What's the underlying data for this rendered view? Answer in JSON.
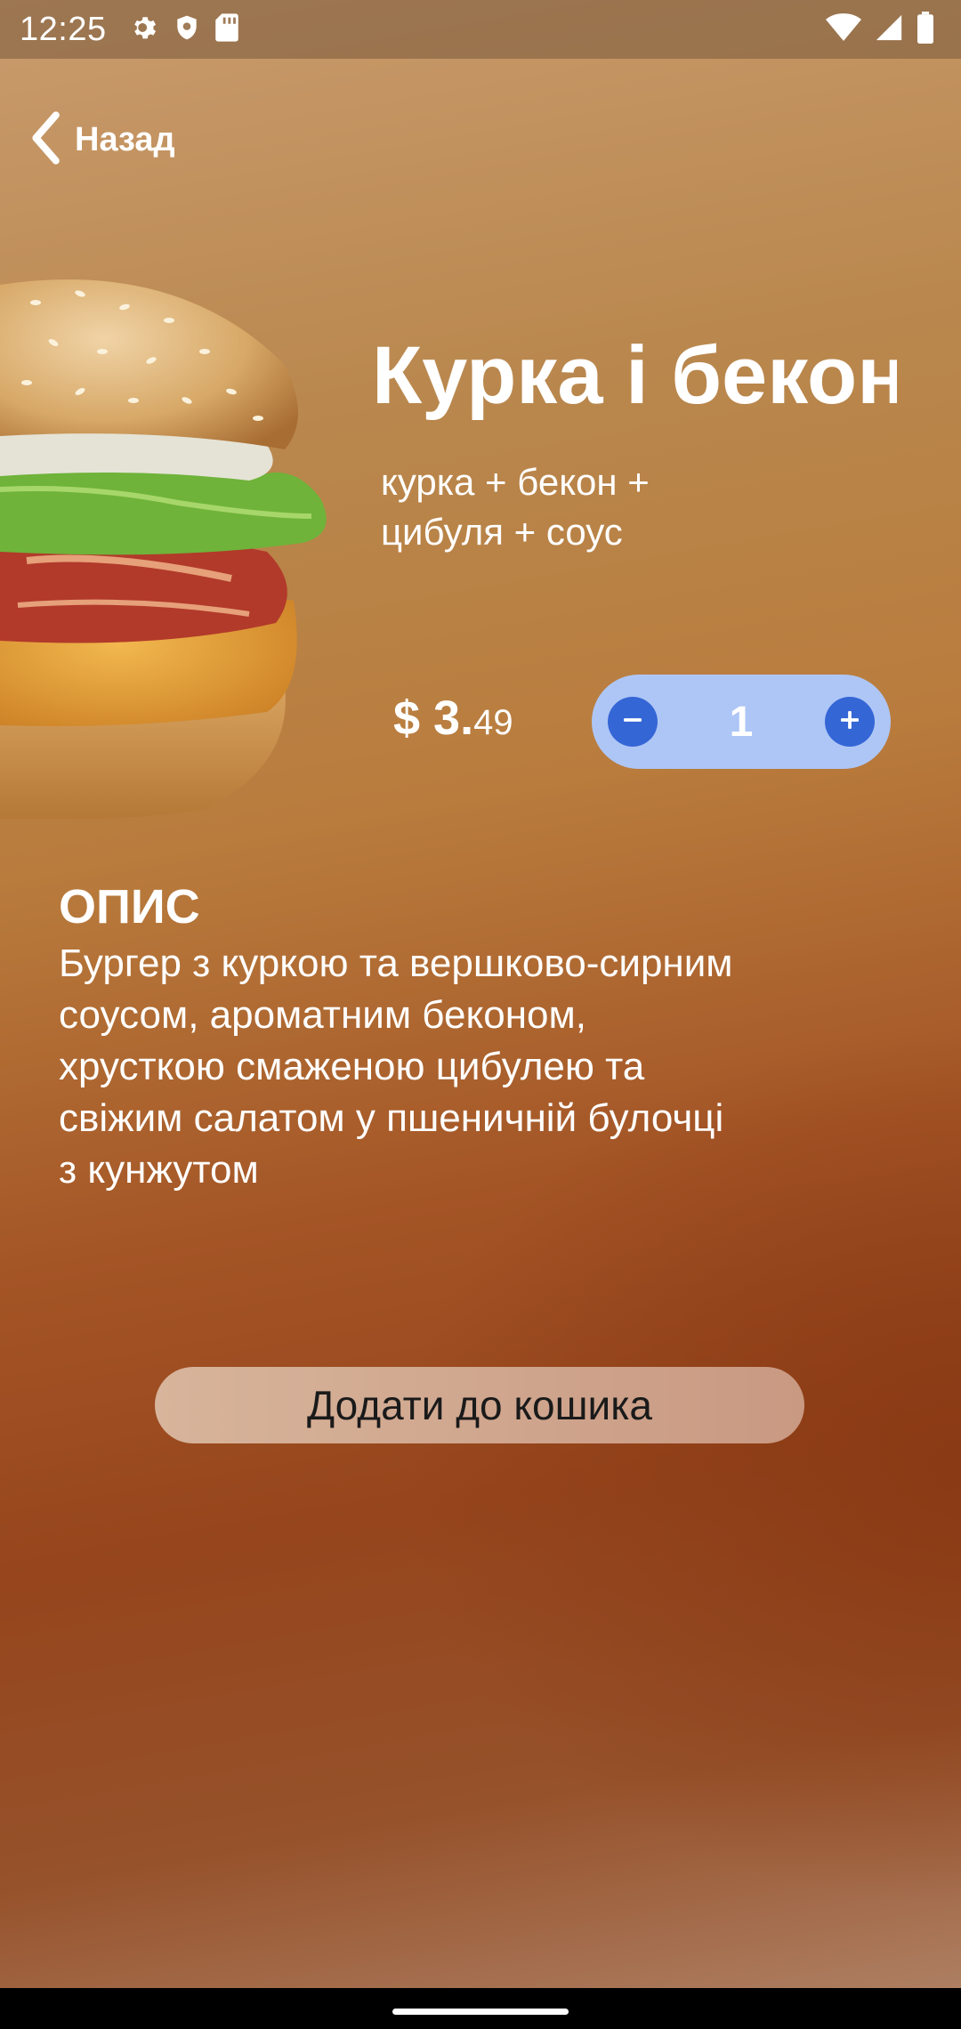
{
  "status_bar": {
    "time": "12:25",
    "left_icons": [
      "gear-icon",
      "shield-icon",
      "sd-card-icon"
    ],
    "right_icons": [
      "wifi-icon",
      "cellular-signal-icon",
      "battery-icon"
    ]
  },
  "header": {
    "back_label": "Назад"
  },
  "product": {
    "title": "Курка і бекон",
    "subtitle": "курка + бекон + цибуля + соус",
    "price_main": "$ 3.",
    "price_cents": "49",
    "quantity": "1"
  },
  "description": {
    "heading": "ОПИС",
    "text": "Бургер з куркою та вершково-сирним соусом, ароматним беконом, хрусткою смаженою цибулею та свіжим салатом у пшеничній булочці з кунжутом"
  },
  "actions": {
    "add_to_cart_label": "Додати до кошика"
  },
  "colors": {
    "stepper_bg": "#aec6f6",
    "stepper_button": "#3566d6",
    "cart_button": "#d7b49b"
  }
}
